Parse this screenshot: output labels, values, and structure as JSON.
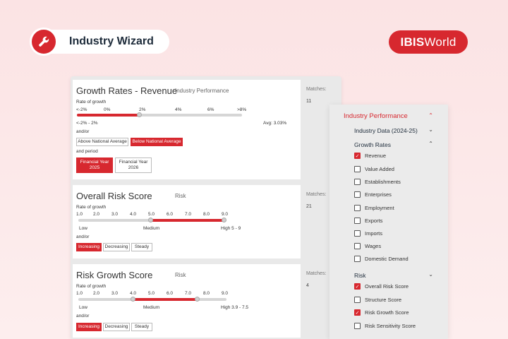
{
  "header": {
    "wizard_title": "Industry Wizard",
    "logo_bold": "IBIS",
    "logo_rest": "World"
  },
  "cards": [
    {
      "title": "Growth Rates - Revenue",
      "subtitle": "Industry Performance",
      "rate_label": "Rate of growth",
      "ticks": [
        "<-2%",
        "0%",
        "2%",
        "4%",
        "6%",
        ">8%"
      ],
      "range_label": "<-2% - 2%",
      "avg": "Avg: 3.03%",
      "andor": "and/or",
      "filter_buttons": [
        "Above National Average",
        "Below National Average"
      ],
      "period_label": "and period",
      "period_buttons": [
        "Financial Year 2025",
        "Financial Year 2026"
      ],
      "matches_label": "Matches:",
      "matches": "11"
    },
    {
      "title": "Overall Risk Score",
      "subtitle": "Risk",
      "rate_label": "Rate of growth",
      "ticks": [
        "1.0",
        "2.0",
        "3.0",
        "4.0",
        "5.0",
        "6.0",
        "7.0",
        "8.0",
        "9.0"
      ],
      "low": "Low",
      "medium": "Medium",
      "high": "High 5 - 9",
      "andor": "and/or",
      "trend_buttons": [
        "Increasing",
        "Decreasing",
        "Steady"
      ],
      "matches_label": "Matches:",
      "matches": "21"
    },
    {
      "title": "Risk Growth Score",
      "subtitle": "Risk",
      "rate_label": "Rate of growth",
      "ticks": [
        "1.0",
        "2.0",
        "3.0",
        "4.0",
        "5.0",
        "6.0",
        "7.0",
        "8.0",
        "9.0"
      ],
      "low": "Low",
      "medium": "Medium",
      "high": "High 3.9 - 7.5",
      "andor": "and/or",
      "trend_buttons": [
        "Increasing",
        "Decreasing",
        "Steady"
      ],
      "matches_label": "Matches:",
      "matches": "4"
    }
  ],
  "sidebar": {
    "heading": "Industry Performance",
    "industry_data": "Industry Data (2024-25)",
    "growth_rates": "Growth Rates",
    "growth_items": [
      {
        "label": "Revenue",
        "checked": true
      },
      {
        "label": "Value Added",
        "checked": false
      },
      {
        "label": "Establishments",
        "checked": false
      },
      {
        "label": "Enterprises",
        "checked": false
      },
      {
        "label": "Employment",
        "checked": false
      },
      {
        "label": "Exports",
        "checked": false
      },
      {
        "label": "Imports",
        "checked": false
      },
      {
        "label": "Wages",
        "checked": false
      },
      {
        "label": "Domestic Demand",
        "checked": false
      }
    ],
    "risk": "Risk",
    "risk_items": [
      {
        "label": "Overall Risk Score",
        "checked": true
      },
      {
        "label": "Structure Score",
        "checked": false
      },
      {
        "label": "Risk Growth Score",
        "checked": true
      },
      {
        "label": "Risk Sensitivity Score",
        "checked": false
      }
    ]
  },
  "colors": {
    "accent": "#d7282f",
    "navy": "#1d2b3a"
  }
}
